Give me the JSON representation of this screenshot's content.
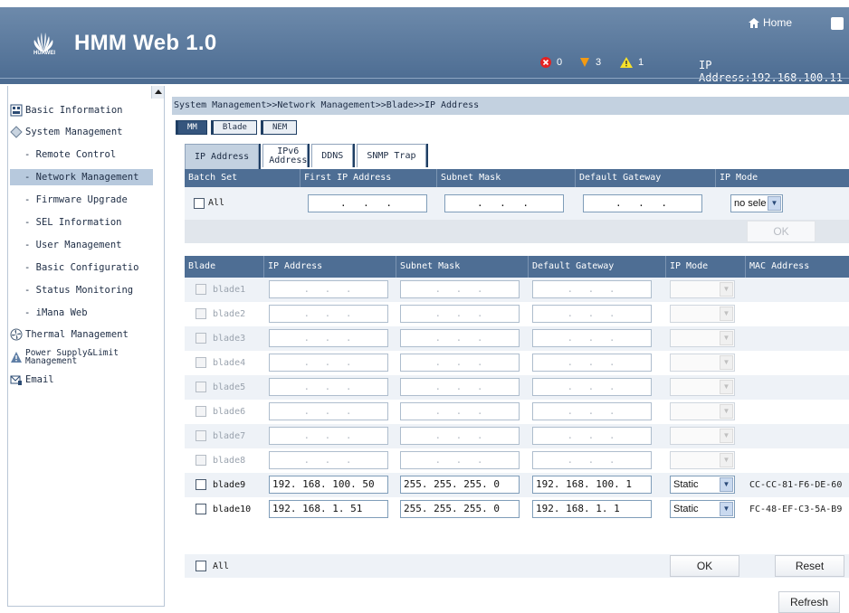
{
  "header": {
    "brand": "HUAWEI",
    "app_title": "HMM Web 1.0",
    "home_label": "Home",
    "alarms": {
      "critical": "0",
      "major": "3",
      "minor": "1"
    },
    "ip_status": "IP Address:192.168.100.11"
  },
  "sidebar": {
    "items": [
      {
        "label": "Basic Information"
      },
      {
        "label": "System Management"
      },
      {
        "label": "- Remote Control"
      },
      {
        "label": "- Network Management"
      },
      {
        "label": "- Firmware Upgrade"
      },
      {
        "label": "- SEL Information"
      },
      {
        "label": "- User Management"
      },
      {
        "label": "- Basic Configuratio"
      },
      {
        "label": "- Status Monitoring"
      },
      {
        "label": "- iMana Web"
      },
      {
        "label": "Thermal Management"
      },
      {
        "label": "Power Supply&Limit Management"
      },
      {
        "label": "Email"
      }
    ]
  },
  "main": {
    "breadcrumb": "System Management>>Network Management>>Blade>>IP Address",
    "subtabs": [
      "MM",
      "Blade",
      "NEM"
    ],
    "tabs": [
      "IP Address",
      "IPv6 Address",
      "DDNS",
      "SNMP Trap"
    ],
    "batch": {
      "headers": [
        "Batch Set",
        "First IP Address",
        "Subnet Mask",
        "Default Gateway",
        "IP Mode"
      ],
      "all_label": "All",
      "empty_ip": ". . .",
      "mode_value": "no sele",
      "ok_label": "OK"
    },
    "table": {
      "headers": [
        "Blade",
        "IP Address",
        "Subnet Mask",
        "Default Gateway",
        "IP Mode",
        "MAC Address"
      ],
      "rows": [
        {
          "blade": "blade1",
          "ip": ".  .  .",
          "mask": ".  .  .",
          "gw": ".  .  .",
          "mode": "",
          "mac": ""
        },
        {
          "blade": "blade2",
          "ip": ".  .  .",
          "mask": ".  .  .",
          "gw": ".  .  .",
          "mode": "",
          "mac": ""
        },
        {
          "blade": "blade3",
          "ip": ".  .  .",
          "mask": ".  .  .",
          "gw": ".  .  .",
          "mode": "",
          "mac": ""
        },
        {
          "blade": "blade4",
          "ip": ".  .  .",
          "mask": ".  .  .",
          "gw": ".  .  .",
          "mode": "",
          "mac": ""
        },
        {
          "blade": "blade5",
          "ip": ".  .  .",
          "mask": ".  .  .",
          "gw": ".  .  .",
          "mode": "",
          "mac": ""
        },
        {
          "blade": "blade6",
          "ip": ".  .  .",
          "mask": ".  .  .",
          "gw": ".  .  .",
          "mode": "",
          "mac": ""
        },
        {
          "blade": "blade7",
          "ip": ".  .  .",
          "mask": ".  .  .",
          "gw": ".  .  .",
          "mode": "",
          "mac": ""
        },
        {
          "blade": "blade8",
          "ip": ".  .  .",
          "mask": ".  .  .",
          "gw": ".  .  .",
          "mode": "",
          "mac": ""
        },
        {
          "blade": "blade9",
          "ip": "192. 168. 100. 50",
          "mask": "255. 255. 255. 0",
          "gw": "192. 168. 100. 1",
          "mode": "Static",
          "mac": "CC-CC-81-F6-DE-60"
        },
        {
          "blade": "blade10",
          "ip": "192. 168. 1. 51",
          "mask": "255. 255. 255. 0",
          "gw": "192. 168. 1. 1",
          "mode": "Static",
          "mac": "FC-48-EF-C3-5A-B9"
        }
      ],
      "all_label": "All",
      "ok_label": "OK",
      "reset_label": "Reset"
    },
    "refresh_label": "Refresh"
  },
  "colors": {
    "header_bg": "#5a7aa0",
    "table_header_bg": "#4e6e94",
    "breadcrumb_bg": "#c3d1e0",
    "selected_nav_bg": "#b7c9dd"
  }
}
